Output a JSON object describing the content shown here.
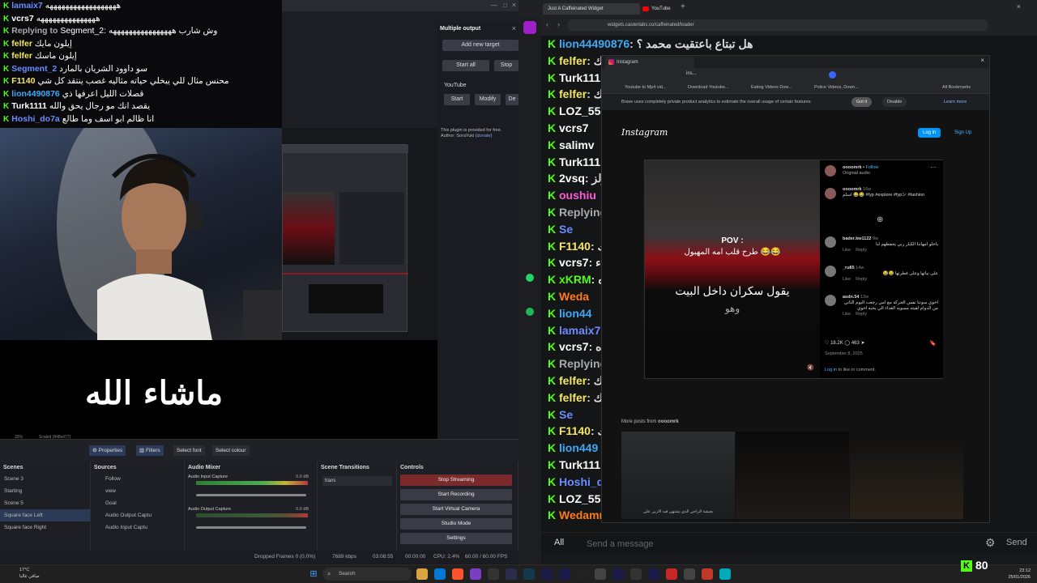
{
  "chat_overlay": {
    "lines": [
      {
        "user": "lamaix7",
        "msg": "ههههههههههههههههههه",
        "color": "#6a8cff"
      },
      {
        "user": "vcrs7",
        "msg": "هههههههههههههههه",
        "color": "#ffffff"
      },
      {
        "user": "Replying to",
        "msg": "Segment_2: وش شارب ههههههههههههههههه",
        "color": "#aaaaaa"
      },
      {
        "user": "felfer",
        "msg": "إيلون مايك",
        "color": "#f5e663"
      },
      {
        "user": "felfer",
        "msg": "إيلون ماسك",
        "color": "#f5e663"
      },
      {
        "user": "Segment_2",
        "msg": "سو داوود الشريان بالمارد",
        "color": "#6a8cff"
      },
      {
        "user": "F1140",
        "msg": "محنس مثال للي يبخلي حياته مثاليه غصب ينتقد كل شي",
        "color": "#f5e663"
      },
      {
        "user": "lion4490876",
        "msg": "قصلات الليل اعرفها ذي",
        "color": "#3fa9f5"
      },
      {
        "user": "Turk1111",
        "msg": "يقصد انك مو رجال يحق والله",
        "color": "#ffffff"
      },
      {
        "user": "Hoshi_do7a",
        "msg": "انا ظالم ابو اسف وما طالع",
        "color": "#6a8cff"
      }
    ]
  },
  "webcam_caption": "ماشاء الله",
  "multiple_output": {
    "title": "Multiple output",
    "add_target": "Add new target",
    "start_all": "Start all",
    "stop_all": "Stop",
    "youtube_label": "YouTube",
    "start": "Start",
    "modify": "Modify",
    "delete": "De",
    "note": "This plugin is provided for free. Author: SoraYuki (",
    "donate": "donate",
    "note_end": ")"
  },
  "obs": {
    "toolbar": {
      "properties": "Properties",
      "filters": "Filters",
      "select_font": "Select font",
      "select_colour": "Select colour",
      "zoom": "33%",
      "scaled": "Scaled (848x477)"
    },
    "scenes": {
      "title": "Scenes",
      "items": [
        "Scene 3",
        "Starting",
        "Scene 5",
        "Square face Left",
        "Square face Right"
      ]
    },
    "sources": {
      "title": "Sources",
      "items": [
        "Follow",
        "view",
        "Goal",
        "Audio Output Captu",
        "Audio Input Captu"
      ]
    },
    "mixer": {
      "title": "Audio Mixer",
      "channels": [
        {
          "name": "Audio Input Capture",
          "db": "0.0 dB"
        },
        {
          "name": "Audio Output Capture",
          "db": "0.0 dB"
        }
      ]
    },
    "transitions": {
      "title": "Scene Transitions",
      "selected": "trans"
    },
    "controls": {
      "title": "Controls",
      "stop_streaming": "Stop Streaming",
      "start_recording": "Start Recording",
      "start_virtual_camera": "Start Virtual Camera",
      "studio_mode": "Studio Mode",
      "settings": "Settings"
    },
    "status": {
      "dropped": "Dropped Frames 0 (0.0%)",
      "bitrate": "7689 kbps",
      "stream_time": "03:08:55",
      "rec_time": "00:00:00",
      "cpu": "CPU: 2.4%",
      "fps": "60.00 / 60.00 FPS"
    }
  },
  "browser": {
    "tab1": "Just A Caffeinated Widget",
    "tab2": "YouTube",
    "url": "widgets.casterlabs.co/caffeinated/loader"
  },
  "kick_chat": {
    "lines": [
      {
        "user": "lion44490876",
        "msg": ": هل تبتاع باعتقيت محمد ؟",
        "color": "#3fa9f5"
      },
      {
        "user": "felfer",
        "msg": ": ك",
        "color": "#f5e663"
      },
      {
        "user": "Turk111",
        "msg": "",
        "color": "#ffffff"
      },
      {
        "user": "felfer",
        "msg": ": ك",
        "color": "#f5e663"
      },
      {
        "user": "LOZ_555",
        "msg": "",
        "color": "#ffffff"
      },
      {
        "user": "vcrs7",
        "msg": "",
        "color": "#ffffff"
      },
      {
        "user": "salimv",
        "msg": "",
        "color": "#ffffff"
      },
      {
        "user": "Turk111",
        "msg": "",
        "color": "#ffffff"
      },
      {
        "user": "2vsq",
        "msg": ": زلز",
        "color": "#ffffff"
      },
      {
        "user": "oushiu",
        "msg": "",
        "color": "#ff5ad6"
      },
      {
        "user": "Replying to",
        "msg": "",
        "color": "#aaaaaa"
      },
      {
        "user": "Se",
        "msg": "",
        "color": "#6a8cff"
      },
      {
        "user": "F1140",
        "msg": ": ك",
        "color": "#f5e663"
      },
      {
        "user": "vcrs7",
        "msg": ": ء",
        "color": "#ffffff"
      },
      {
        "user": "xKRM",
        "msg": ": ه",
        "color": "#53fc18"
      },
      {
        "user": "Weda",
        "msg": "",
        "color": "#ff7a1a"
      },
      {
        "user": "lion44",
        "msg": "",
        "color": "#3fa9f5"
      },
      {
        "user": "lamaix7",
        "msg": "",
        "color": "#6a8cff"
      },
      {
        "user": "vcrs7",
        "msg": ": ه",
        "color": "#ffffff"
      },
      {
        "user": "Replying to",
        "msg": "",
        "color": "#aaaaaa"
      },
      {
        "user": "felfer",
        "msg": ": ك",
        "color": "#f5e663"
      },
      {
        "user": "felfer",
        "msg": ": ك",
        "color": "#f5e663"
      },
      {
        "user": "Se",
        "msg": "",
        "color": "#6a8cff"
      },
      {
        "user": "F1140",
        "msg": ": ك",
        "color": "#f5e663"
      },
      {
        "user": "lion449",
        "msg": "",
        "color": "#3fa9f5"
      },
      {
        "user": "Turk111",
        "msg": "",
        "color": "#ffffff"
      },
      {
        "user": "Hoshi_d",
        "msg": "",
        "color": "#6a8cff"
      },
      {
        "user": "LOZ_555",
        "msg": "",
        "color": "#ffffff"
      },
      {
        "user": "Wedamn",
        "msg": "",
        "color": "#ff7a1a"
      }
    ],
    "input": {
      "all": "All",
      "placeholder": "Send a message",
      "send": "Send"
    }
  },
  "instagram_window": {
    "tab": "Instagram",
    "toolbar_text": "ins...",
    "bookmarks": [
      "Youtube to Mp4 vid...",
      "Download Youtube...",
      "Eating Videos Dow...",
      "Police Videos, Down..."
    ],
    "all_bookmarks": "All Bookmarks",
    "banner": "Brave uses completely private product analytics to estimate the overall usage of certain features",
    "got_it": "Got it",
    "disable": "Disable",
    "learn_more": "Learn more",
    "logo": "Instagram",
    "login": "Log in",
    "signup": "Sign Up",
    "post": {
      "author": "oooomrk",
      "follow": "Follow",
      "original_audio": "Original audio",
      "caption_user": "oooomrk",
      "caption_age": "16w",
      "caption": "اسلم 😂😂 #fyp #explore #fypシ #fashion",
      "video_pov": "POV :",
      "video_line1": "طرح قلب امه المهبول 😂😂",
      "video_line2": "يقول سكران داخل البيت",
      "video_line3": "وهو",
      "comments": [
        {
          "user": "bader.kw1122",
          "age": "9w",
          "text": "ياخلو امهاتنا الكبار ربي يحفظهم لنا",
          "like": "Like",
          "reply": "Reply"
        },
        {
          "user": "_ru85",
          "age": "14w",
          "text": "على نياتها وعلى فطرتها 😂😂",
          "like": "Like",
          "reply": "Reply"
        },
        {
          "user": "asdn.54",
          "age": "12w",
          "text": "اخوي سوتنا نفس الحركة مع امي رجعت اليوم الثاني من الدوام لقيته مسويه الغداء الي يحبه اخوي",
          "like": "Like",
          "reply": "Reply"
        }
      ],
      "likes": "18.2K",
      "comment_count": "463",
      "date": "September 8, 2025",
      "login_prompt_link": "Log in",
      "login_prompt_rest": "to like or comment."
    },
    "more_posts": "More posts from",
    "more_posts_user": "oooomrk",
    "thumb_caption": "يعيشة الراحي الذي يشتهي فيه الاربي علي"
  },
  "taskbar": {
    "weather_temp": "17°C",
    "weather_desc": "صافي غالبا",
    "search": "Search",
    "time": "23:12",
    "date": "25/01/2026",
    "kick_viewers": "80"
  }
}
